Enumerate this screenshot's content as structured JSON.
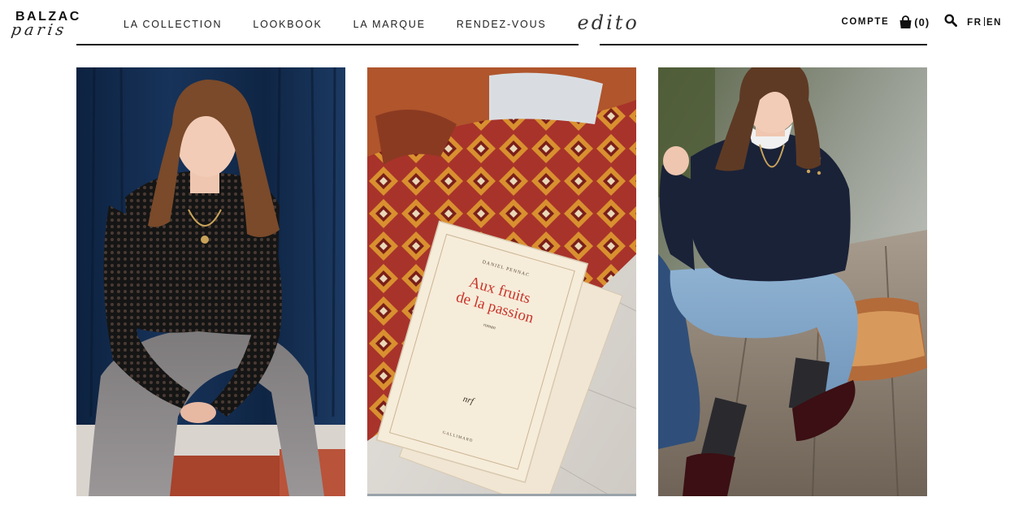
{
  "brand": {
    "name": "BALZAC",
    "sub": "paris"
  },
  "nav": {
    "items": [
      {
        "label": "LA COLLECTION"
      },
      {
        "label": "LOOKBOOK"
      },
      {
        "label": "LA MARQUE"
      },
      {
        "label": "RENDEZ-VOUS"
      }
    ],
    "edito": "edito"
  },
  "tools": {
    "account": "COMPTE",
    "cart_count": "(0)",
    "lang_fr": "FR",
    "lang_en": "EN"
  },
  "book": {
    "author": "DANIEL PENNAC",
    "title_line1": "Aux fruits",
    "title_line2": "de la passion",
    "genre": "roman",
    "mark": "nrf",
    "publisher": "GALLIMARD"
  },
  "icons": {
    "cart": "shopping-bag-icon",
    "search": "search-icon"
  }
}
